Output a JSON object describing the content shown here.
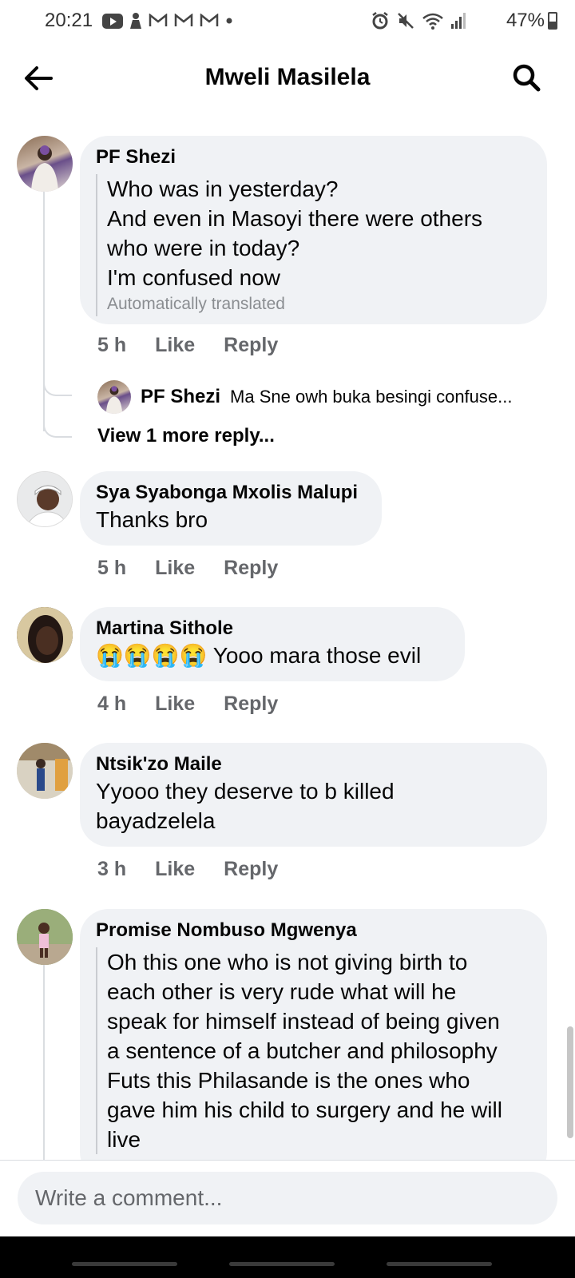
{
  "status_bar": {
    "time": "20:21",
    "battery_percent": "47%",
    "battery_level": 0.47,
    "left_icons": [
      "youtube-icon",
      "person-icon",
      "gmail-icon",
      "gmail-icon",
      "gmail-icon",
      "dot-icon"
    ],
    "right_icons": [
      "alarm-icon",
      "mute-icon",
      "wifi-icon",
      "signal-icon"
    ]
  },
  "header": {
    "title": "Mweli Masilela"
  },
  "comments": [
    {
      "author": "PF Shezi",
      "lines": [
        "Who was in yesterday?",
        "And even in Masoyi there were others",
        "who were in today?",
        "I'm confused now"
      ],
      "translated_label": "Automatically translated",
      "time": "5 h",
      "like": "Like",
      "reply": "Reply",
      "replies": {
        "author": "PF Shezi",
        "text": "Ma Sne owh buka besingi confuse...",
        "view_more": "View 1 more reply..."
      }
    },
    {
      "author": "Sya Syabonga Mxolis Malupi",
      "text": "Thanks bro",
      "time": "5 h",
      "like": "Like",
      "reply": "Reply"
    },
    {
      "author": "Martina Sithole",
      "emoji": "😭😭😭😭",
      "text": "Yooo mara those evil",
      "time": "4 h",
      "like": "Like",
      "reply": "Reply"
    },
    {
      "author": "Ntsik'zo Maile",
      "lines": [
        "Yyooo they deserve to b killed",
        "bayadzelela"
      ],
      "time": "3 h",
      "like": "Like",
      "reply": "Reply"
    },
    {
      "author": "Promise Nombuso Mgwenya",
      "lines": [
        "Oh this one who is not giving birth to",
        "each other is very rude what will he",
        "speak for himself instead of being given",
        "a sentence of a butcher and philosophy",
        "Futs this Philasande is the ones who",
        "gave him his child to surgery and he will",
        "live"
      ]
    }
  ],
  "composer": {
    "placeholder": "Write a comment..."
  },
  "colors": {
    "bubble": "#f0f2f5",
    "meta_text": "#65676b",
    "primary_text": "#050505"
  }
}
